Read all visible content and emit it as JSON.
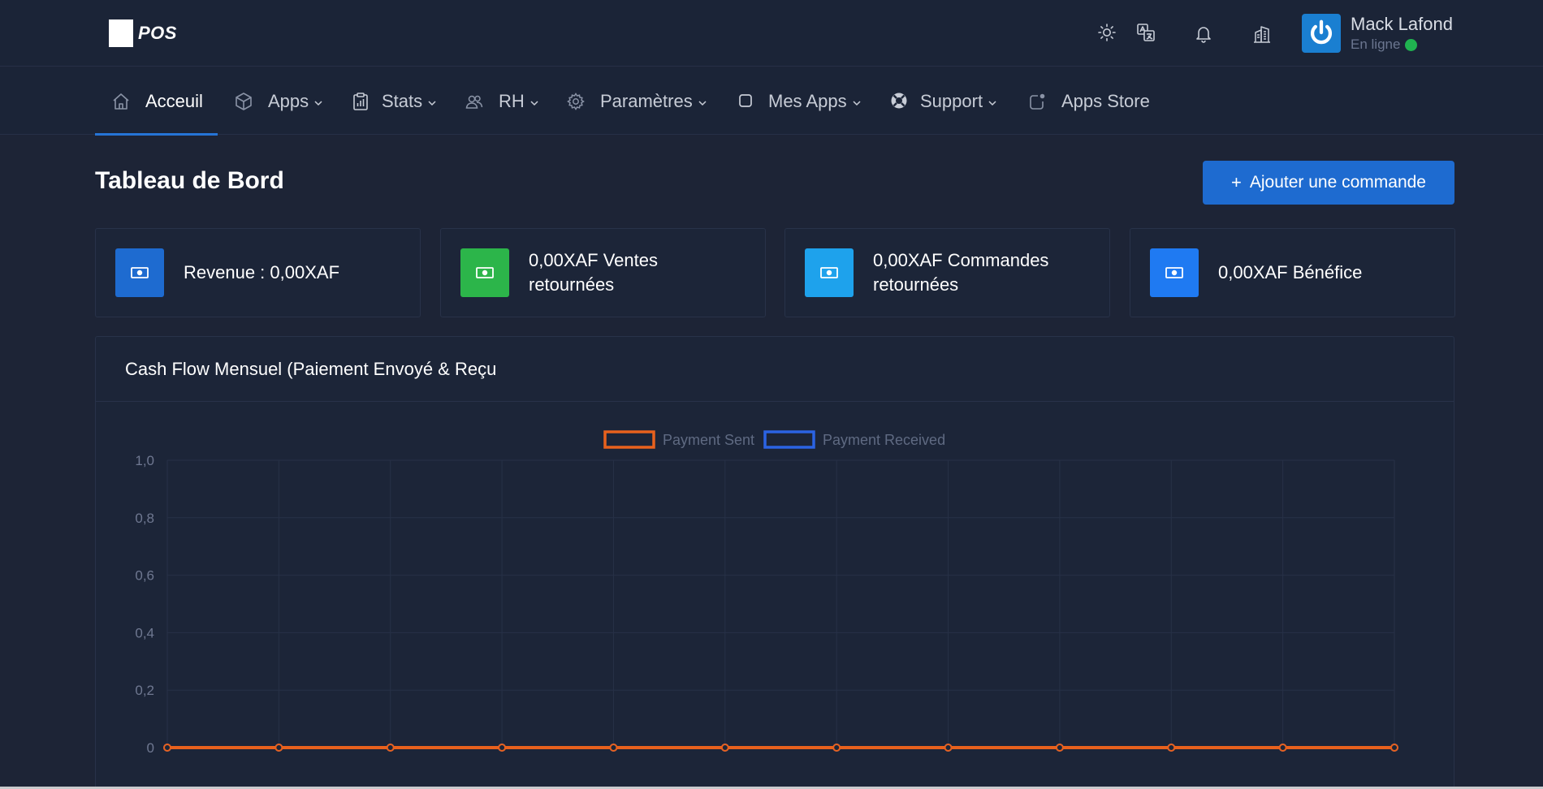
{
  "app": {
    "logo_text": "POS"
  },
  "header": {
    "icons": [
      "sun-icon",
      "translate-icon",
      "bell-icon",
      "building-icon"
    ],
    "user": {
      "name": "Mack Lafond",
      "status": "En ligne",
      "status_color": "#20b350"
    }
  },
  "nav": {
    "items": [
      {
        "label": "Acceuil",
        "icon": "home-icon",
        "dropdown": false,
        "active": true
      },
      {
        "label": "Apps",
        "icon": "box-icon",
        "dropdown": true
      },
      {
        "label": "Stats",
        "icon": "clipboard-chart-icon",
        "dropdown": true
      },
      {
        "label": "RH",
        "icon": "users-icon",
        "dropdown": true
      },
      {
        "label": "Paramètres",
        "icon": "gear-icon",
        "dropdown": true
      },
      {
        "label": "Mes Apps",
        "icon": "square-icon",
        "dropdown": true
      },
      {
        "label": "Support",
        "icon": "lifebuoy-icon",
        "dropdown": true
      },
      {
        "label": "Apps Store",
        "icon": "app-badge-icon",
        "dropdown": false
      }
    ]
  },
  "main": {
    "title": "Tableau de Bord",
    "add_button": {
      "icon": "+",
      "label": "Ajouter une commande"
    },
    "cards": [
      {
        "text": "Revenue : 0,00XAF",
        "icon": "money-icon",
        "color": "#1e6bd0"
      },
      {
        "text": "0,00XAF Ventes retournées",
        "icon": "money-icon",
        "color": "#2cb54a"
      },
      {
        "text": "0,00XAF Commandes retournées",
        "icon": "money-icon",
        "color": "#1ea2ec"
      },
      {
        "text": "0,00XAF Bénéfice",
        "icon": "money-icon",
        "color": "#1f7af2"
      }
    ]
  },
  "chart_data": {
    "type": "line",
    "title": "Cash Flow Mensuel (Paiement Envoyé & Reçu",
    "xlabel": "",
    "ylabel": "",
    "ylim": [
      0,
      1.0
    ],
    "y_ticks": [
      "1,0",
      "0,8",
      "0,6",
      "0,4",
      "0,2",
      "0"
    ],
    "grid": true,
    "legend_position": "top",
    "series": [
      {
        "name": "Payment Sent",
        "color": "#e8611d",
        "values": [
          0,
          0,
          0,
          0,
          0,
          0,
          0,
          0,
          0,
          0,
          0,
          0
        ]
      },
      {
        "name": "Payment Received",
        "color": "#2b63e3",
        "values": [
          0,
          0,
          0,
          0,
          0,
          0,
          0,
          0,
          0,
          0,
          0,
          0
        ]
      }
    ]
  }
}
